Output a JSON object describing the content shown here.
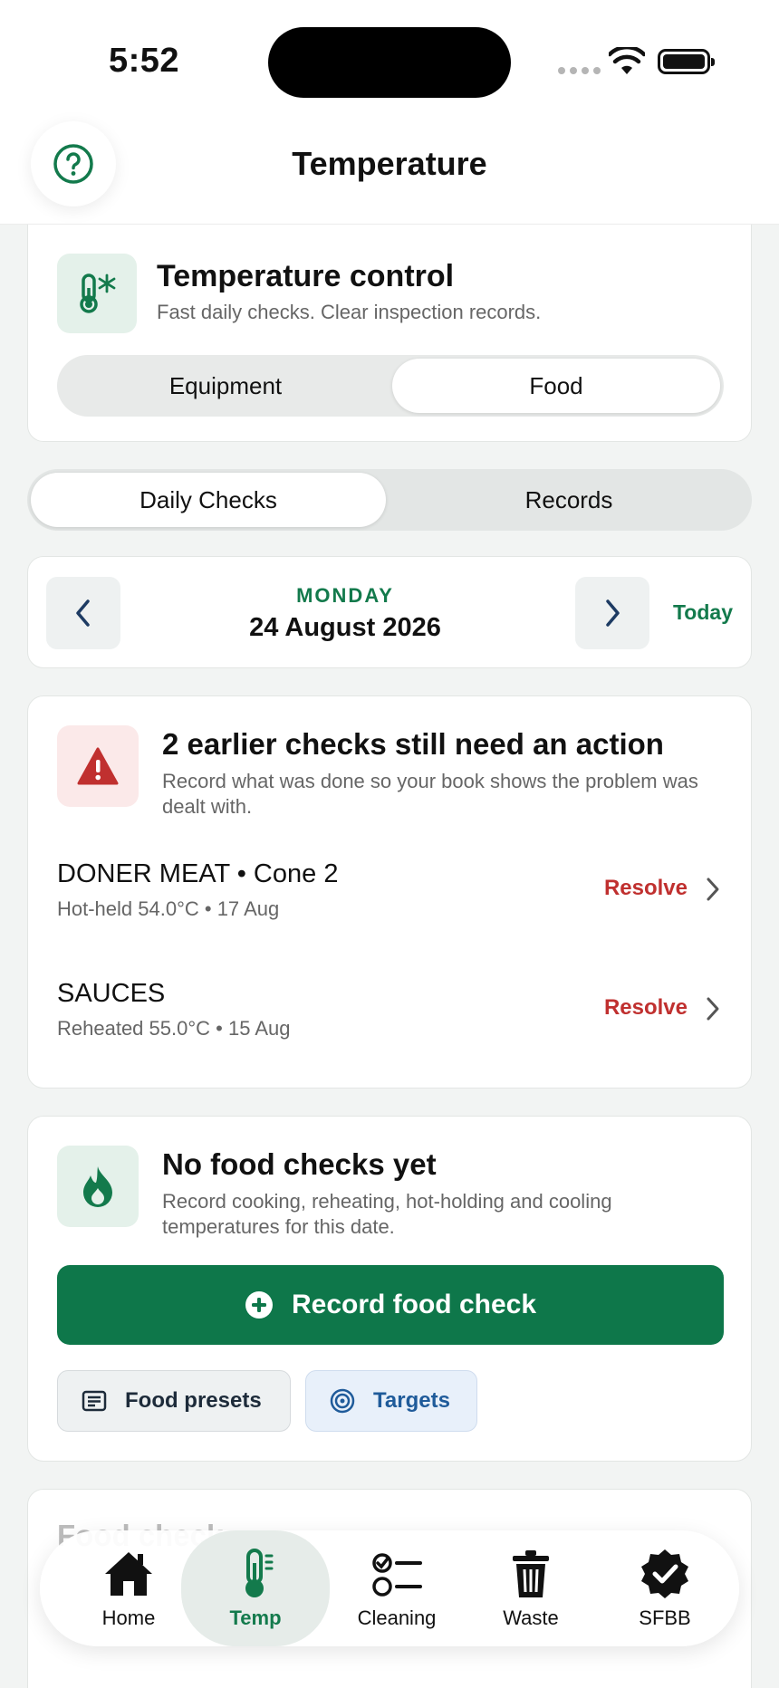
{
  "status": {
    "time": "5:52"
  },
  "header": {
    "title": "Temperature",
    "help_icon": "question-circle-icon"
  },
  "temp_control": {
    "title": "Temperature control",
    "subtitle": "Fast daily checks. Clear inspection records.",
    "segments": [
      "Equipment",
      "Food"
    ],
    "selected_segment": "Food"
  },
  "tabs": {
    "items": [
      "Daily Checks",
      "Records"
    ],
    "selected": "Daily Checks"
  },
  "date_nav": {
    "day": "MONDAY",
    "date": "24 August 2026",
    "today_label": "Today"
  },
  "actions": {
    "title": "2 earlier checks still need an action",
    "subtitle": "Record what was done so your book shows the problem was dealt with.",
    "items": [
      {
        "name": "DONER MEAT • Cone 2",
        "detail": "Hot-held 54.0°C • 17 Aug",
        "action": "Resolve"
      },
      {
        "name": "SAUCES",
        "detail": "Reheated 55.0°C • 15 Aug",
        "action": "Resolve"
      }
    ]
  },
  "food_checks": {
    "title": "No food checks yet",
    "subtitle": "Record cooking, reheating, hot-holding and cooling temperatures for this date.",
    "record_button": "Record food check",
    "presets_button": "Food presets",
    "targets_button": "Targets"
  },
  "peek": {
    "title": "Food check"
  },
  "bottom_nav": {
    "items": [
      "Home",
      "Temp",
      "Cleaning",
      "Waste",
      "SFBB"
    ],
    "selected": "Temp"
  },
  "colors": {
    "brand_green": "#0e774a",
    "danger_red": "#c0302f",
    "link_blue": "#1f5b9a"
  }
}
